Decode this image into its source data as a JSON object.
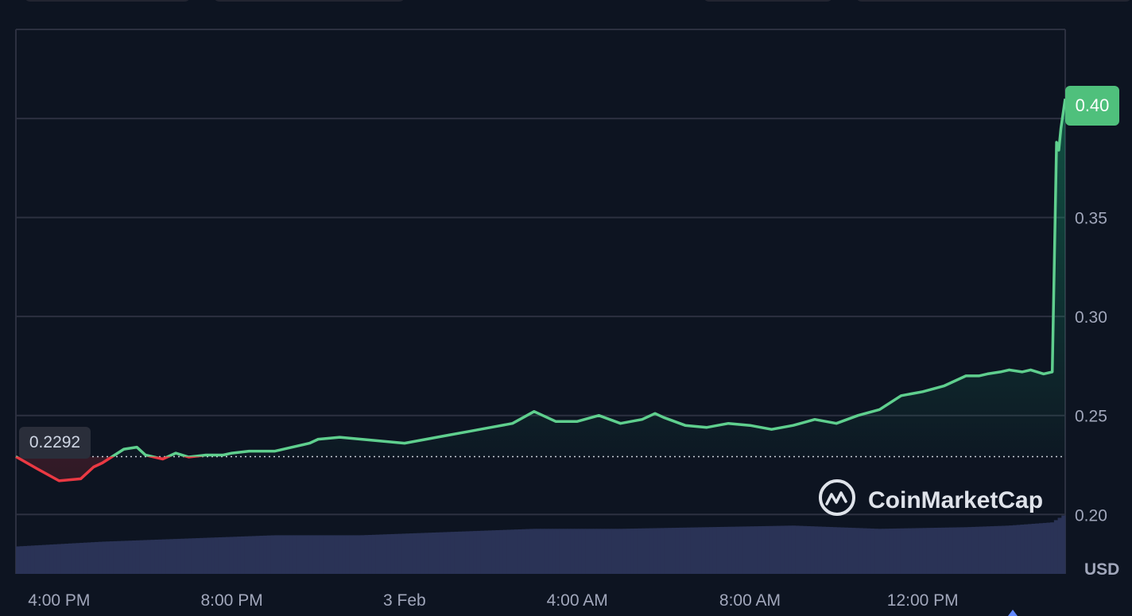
{
  "chart_data": {
    "type": "line",
    "currency_label": "USD",
    "watermark": "CoinMarketCap",
    "open_price": 0.2292,
    "open_label": "0.2292",
    "current_price": 0.41,
    "current_label": "0.40",
    "y_ticks": [
      0.2,
      0.25,
      0.3,
      0.35,
      0.4
    ],
    "y_tick_labels": [
      "0.20",
      "0.25",
      "0.30",
      "0.35",
      "0.40"
    ],
    "ylim": [
      0.17,
      0.445
    ],
    "x_tick_labels": [
      "4:00 PM",
      "8:00 PM",
      "3 Feb",
      "4:00 AM",
      "8:00 AM",
      "12:00 PM"
    ],
    "x_ticks_hours": [
      1,
      5,
      9,
      13,
      17,
      21
    ],
    "x_range_hours": [
      0,
      24.3
    ],
    "grid": true,
    "colors": {
      "up": "#5fcf8e",
      "down": "#ea3943",
      "grid": "#2c3040",
      "volume": "#2a3356",
      "background": "#0d1421"
    },
    "series": [
      {
        "x": [
          0,
          0.5,
          1,
          1.5,
          1.8,
          2,
          2.5,
          2.8,
          3,
          3.4,
          3.7,
          4,
          4.4,
          4.8,
          5,
          5.4,
          5.8,
          6,
          6.4,
          6.8,
          7,
          7.5,
          8,
          8.5,
          9,
          9.5,
          10,
          10.5,
          11,
          11.5,
          12,
          12.5,
          13,
          13.5,
          14,
          14.5,
          14.8,
          15,
          15.5,
          16,
          16.5,
          17,
          17.5,
          18,
          18.5,
          19,
          19.5,
          20,
          20.5,
          21,
          21.5,
          21.8,
          22,
          22.3,
          22.5,
          22.8,
          23,
          23.3,
          23.5,
          23.8,
          24.0,
          24.05,
          24.1,
          24.15,
          24.2,
          24.3
        ],
        "y": [
          0.2292,
          0.223,
          0.217,
          0.218,
          0.224,
          0.226,
          0.233,
          0.234,
          0.23,
          0.228,
          0.231,
          0.229,
          0.23,
          0.23,
          0.231,
          0.232,
          0.232,
          0.232,
          0.234,
          0.236,
          0.238,
          0.239,
          0.238,
          0.237,
          0.236,
          0.238,
          0.24,
          0.242,
          0.244,
          0.246,
          0.252,
          0.247,
          0.247,
          0.25,
          0.246,
          0.248,
          0.251,
          0.249,
          0.245,
          0.244,
          0.246,
          0.245,
          0.243,
          0.245,
          0.248,
          0.246,
          0.25,
          0.253,
          0.26,
          0.262,
          0.265,
          0.268,
          0.27,
          0.27,
          0.271,
          0.272,
          0.273,
          0.272,
          0.273,
          0.271,
          0.272,
          0.33,
          0.388,
          0.384,
          0.395,
          0.41
        ]
      }
    ],
    "volume": {
      "x": [
        0,
        2,
        4,
        6,
        8,
        10,
        12,
        14,
        16,
        18,
        20,
        22,
        23,
        24,
        24.3
      ],
      "values": [
        17,
        20,
        22,
        24,
        24,
        26,
        28,
        28,
        29,
        30,
        28,
        29,
        30,
        32,
        37
      ]
    }
  }
}
